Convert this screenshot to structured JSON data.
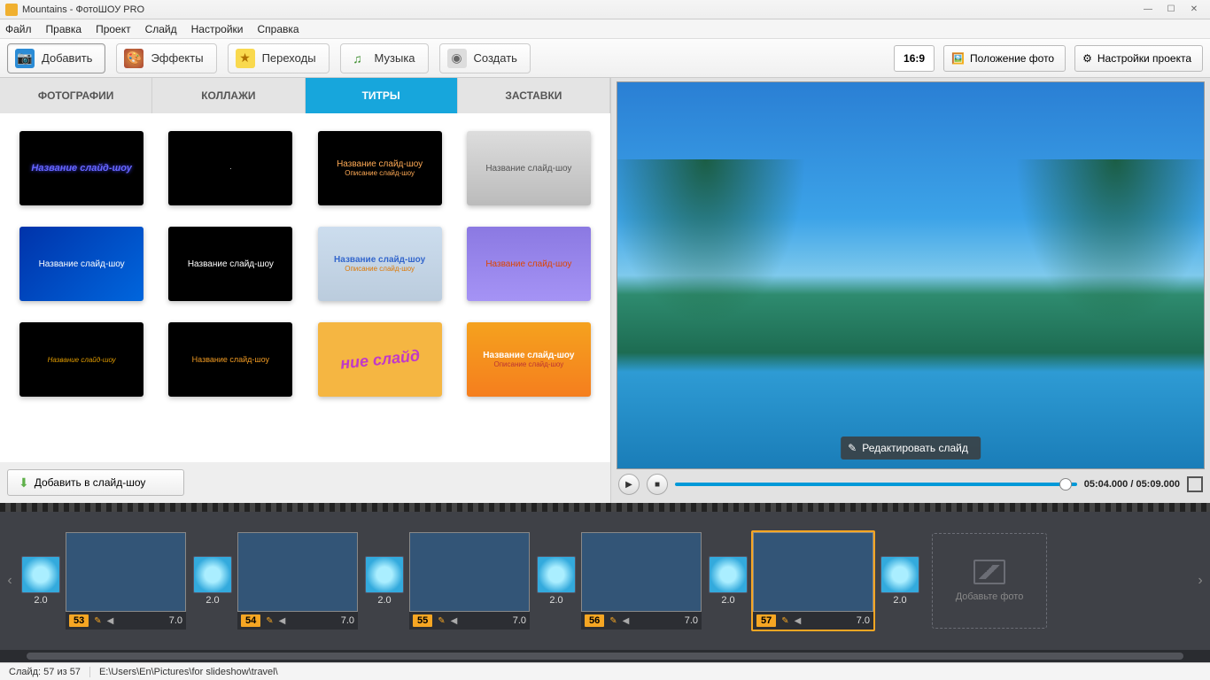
{
  "window": {
    "title": "Mountains - ФотоШОУ PRO"
  },
  "menu": [
    "Файл",
    "Правка",
    "Проект",
    "Слайд",
    "Настройки",
    "Справка"
  ],
  "toolbar": {
    "add": "Добавить",
    "effects": "Эффекты",
    "transitions": "Переходы",
    "music": "Музыка",
    "create": "Создать",
    "ratio": "16:9",
    "photo_position": "Положение фото",
    "project_settings": "Настройки проекта"
  },
  "tabs": {
    "photos": "ФОТОГРАФИИ",
    "collages": "КОЛЛАЖИ",
    "titles": "ТИТРЫ",
    "presets": "ЗАСТАВКИ"
  },
  "title_templates": {
    "row1": {
      "a": "Название слайд-шоу",
      "c1": "Название слайд-шоу",
      "c2": "Описание слайд-шоу",
      "d": "Название слайд-шоу"
    },
    "row2": {
      "a": "Название слайд-шоу",
      "b": "Название слайд-шоу",
      "c1": "Название слайд-шоу",
      "c2": "Описание слайд-шоу",
      "d": "Название слайд-шоу"
    },
    "row3": {
      "a": "Название слайд-шоу",
      "b": "Название слайд-шоу",
      "c": "ние слайд",
      "d1": "Название слайд-шоу",
      "d2": "Описание слайд-шоу"
    }
  },
  "add_to_slideshow": "Добавить в слайд-шоу",
  "preview": {
    "edit_slide": "Редактировать слайд",
    "time": "05:04.000 / 05:09.000"
  },
  "timeline": {
    "trans_dur": "2.0",
    "slides": [
      {
        "num": "53",
        "dur": "7.0"
      },
      {
        "num": "54",
        "dur": "7.0"
      },
      {
        "num": "55",
        "dur": "7.0"
      },
      {
        "num": "56",
        "dur": "7.0"
      },
      {
        "num": "57",
        "dur": "7.0"
      }
    ],
    "add_photo": "Добавьте фото"
  },
  "status": {
    "slide": "Слайд: 57 из 57",
    "path": "E:\\Users\\En\\Pictures\\for slideshow\\travel\\"
  }
}
